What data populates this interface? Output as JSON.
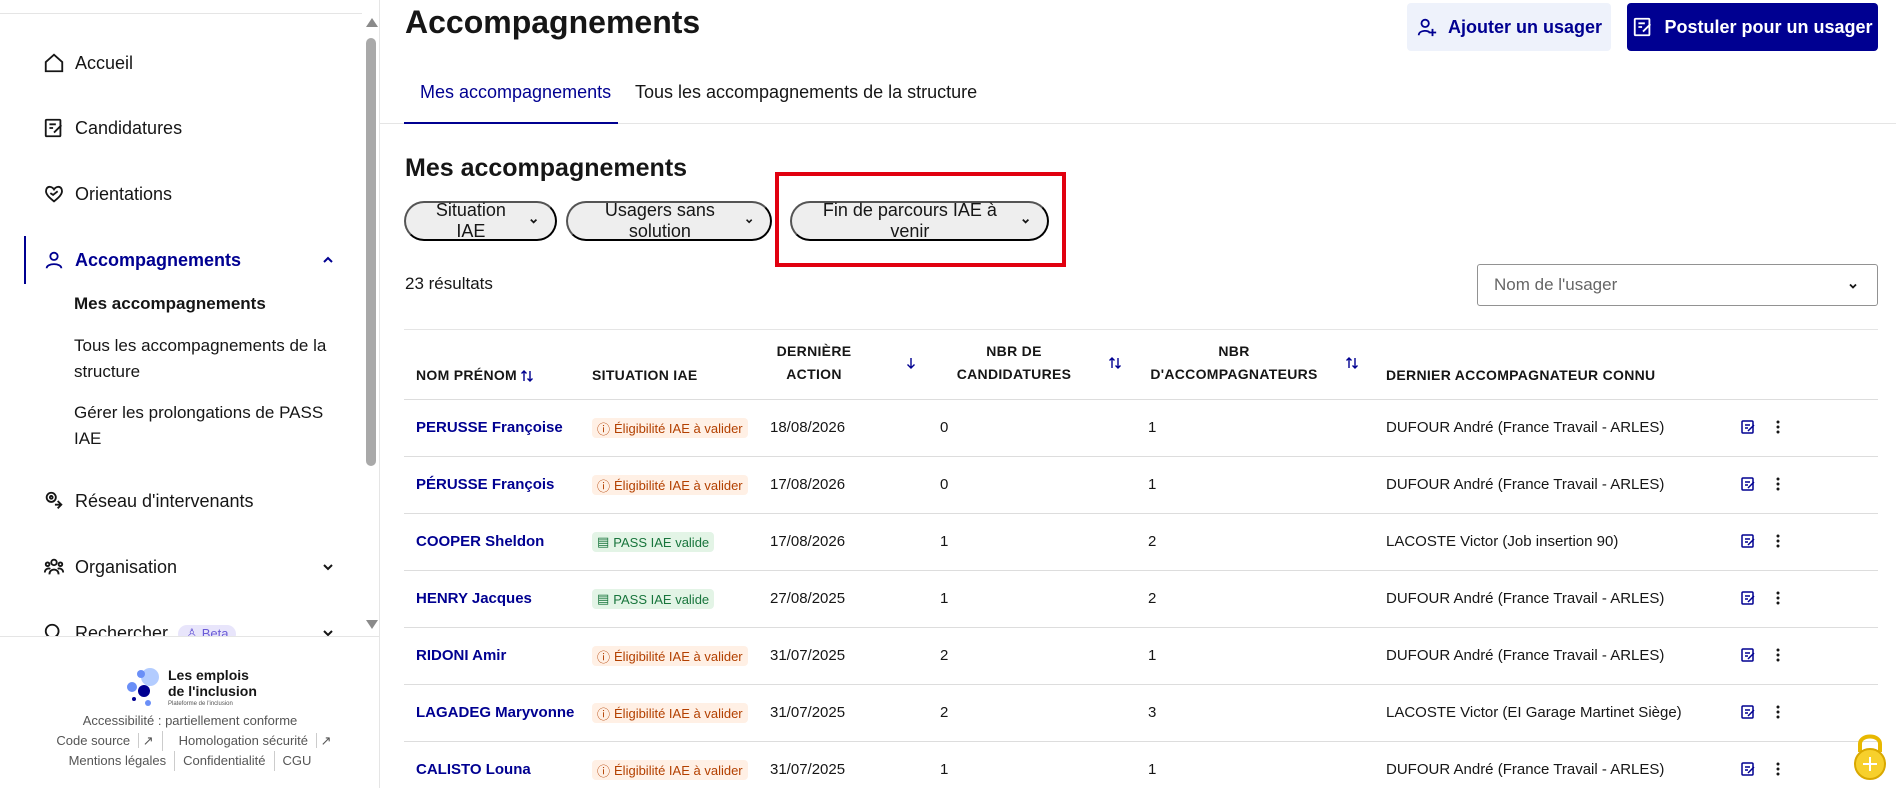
{
  "sidebar": {
    "items": [
      {
        "label": "Accueil",
        "icon": "home-icon"
      },
      {
        "label": "Candidatures",
        "icon": "candidatures-icon"
      },
      {
        "label": "Orientations",
        "icon": "heart-hand-icon"
      },
      {
        "label": "Accompagnements",
        "icon": "user-icon"
      },
      {
        "label": "Réseau d'intervenants",
        "icon": "map-pin-icon"
      },
      {
        "label": "Organisation",
        "icon": "team-icon"
      },
      {
        "label": "Rechercher",
        "icon": "search-icon",
        "badge": "Beta"
      }
    ],
    "sub_items": [
      "Mes accompagnements",
      "Tous les accompagnements de la structure",
      "Gérer les prolongations de PASS IAE"
    ],
    "footer": {
      "logo_line1": "Les emplois",
      "logo_line2": "de l'inclusion",
      "logo_sub": "Plateforme de l'inclusion",
      "links": [
        [
          "Accessibilité : partiellement conforme"
        ],
        [
          "Code source",
          "Homologation sécurité"
        ],
        [
          "Mentions légales",
          "Confidentialité",
          "CGU"
        ]
      ]
    }
  },
  "header": {
    "title": "Accompagnements",
    "add_user_label": "Ajouter un usager",
    "apply_label": "Postuler pour un usager"
  },
  "tabs": [
    "Mes accompagnements",
    "Tous les accompagnements de la structure"
  ],
  "section": {
    "title": "Mes accompagnements",
    "filters": [
      "Situation IAE",
      "Usagers sans solution",
      "Fin de parcours IAE à venir"
    ],
    "results": "23 résultats",
    "search_placeholder": "Nom de l'usager"
  },
  "table": {
    "headers": {
      "name": "NOM PRÉNOM",
      "situation": "SITUATION IAE",
      "last_action_1": "DERNIÈRE",
      "last_action_2": "ACTION",
      "nb_cand_1": "NBR DE",
      "nb_cand_2": "CANDIDATURES",
      "nb_acc_1": "NBR",
      "nb_acc_2": "D'ACCOMPAGNATEURS",
      "last_acc": "DERNIER ACCOMPAGNATEUR CONNU"
    },
    "rows": [
      {
        "name": "PERUSSE Françoise",
        "status": "Éligibilité IAE à valider",
        "status_type": "warn",
        "date": "18/08/2026",
        "nb_cand": "0",
        "nb_acc": "1",
        "accomp": "DUFOUR André (France Travail - ARLES)"
      },
      {
        "name": "PÉRUSSE François",
        "status": "Éligibilité IAE à valider",
        "status_type": "warn",
        "date": "17/08/2026",
        "nb_cand": "0",
        "nb_acc": "1",
        "accomp": "DUFOUR André (France Travail - ARLES)"
      },
      {
        "name": "COOPER Sheldon",
        "status": "PASS IAE valide",
        "status_type": "ok",
        "date": "17/08/2026",
        "nb_cand": "1",
        "nb_acc": "2",
        "accomp": "LACOSTE Victor (Job insertion 90)"
      },
      {
        "name": "HENRY Jacques",
        "status": "PASS IAE valide",
        "status_type": "ok",
        "date": "27/08/2025",
        "nb_cand": "1",
        "nb_acc": "2",
        "accomp": "DUFOUR André (France Travail - ARLES)"
      },
      {
        "name": "RIDONI Amir",
        "status": "Éligibilité IAE à valider",
        "status_type": "warn",
        "date": "31/07/2025",
        "nb_cand": "2",
        "nb_acc": "1",
        "accomp": "DUFOUR André (France Travail - ARLES)"
      },
      {
        "name": "LAGADEG Maryvonne",
        "status": "Éligibilité IAE à valider",
        "status_type": "warn",
        "date": "31/07/2025",
        "nb_cand": "2",
        "nb_acc": "3",
        "accomp": "LACOSTE Victor (EI Garage Martinet Siège)"
      },
      {
        "name": "CALISTO Louna",
        "status": "Éligibilité IAE à valider",
        "status_type": "warn",
        "date": "31/07/2025",
        "nb_cand": "1",
        "nb_acc": "1",
        "accomp": "DUFOUR André (France Travail - ARLES)"
      }
    ]
  },
  "colors": {
    "primary": "#000091",
    "highlight": "#e1000f",
    "warn": "#b34000",
    "ok": "#18753c"
  }
}
